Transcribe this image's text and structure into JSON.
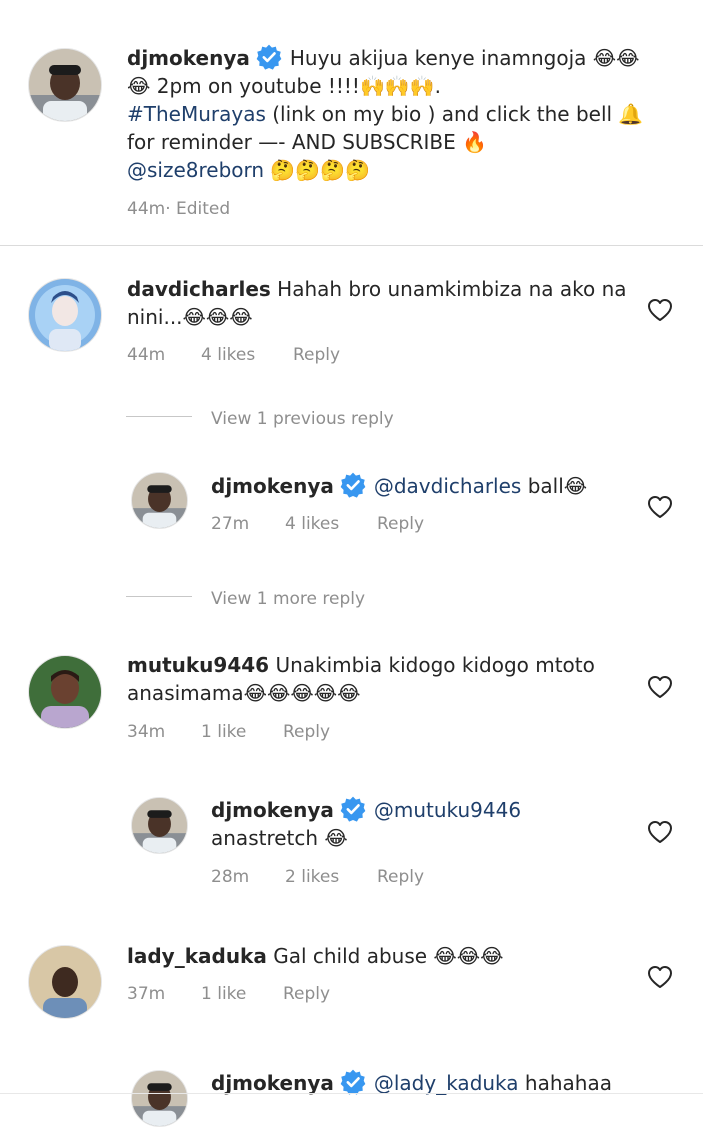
{
  "caption": {
    "username": "djmokenya",
    "line1": "Huyu akijua kenye inamngoja 😂😂",
    "line2": "😂 2pm on youtube !!!!🙌🙌🙌.",
    "hashtag": "#TheMurayas",
    "line3_rest": " (link on my bio ) and click the bell 🔔",
    "line4": "for reminder —- AND SUBSCRIBE 🔥",
    "mention": "@size8reborn",
    "line5_rest": " 🤔🤔🤔🤔",
    "time": "44m",
    "edited": " · Edited"
  },
  "comments": [
    {
      "username": "davdicharles",
      "text1": "Hahah bro unamkimbiza na ako na",
      "text2": "nini...😂😂😂",
      "time": "44m",
      "likes": "4 likes",
      "reply": "Reply"
    },
    {
      "username": "mutuku9446",
      "text1": "Unakimbia kidogo kidogo mtoto",
      "text2": "anasimama😂😂😂😂😂",
      "time": "34m",
      "likes": "1 like",
      "reply": "Reply"
    },
    {
      "username": "lady_kaduka",
      "text1": "Gal child abuse 😂😂😂",
      "time": "37m",
      "likes": "1 like",
      "reply": "Reply"
    }
  ],
  "replies": [
    {
      "username": "djmokenya",
      "mention": "@davdicharles",
      "text": " ball😂",
      "time": "27m",
      "likes": "4 likes",
      "reply": "Reply"
    },
    {
      "username": "djmokenya",
      "mention": "@mutuku9446",
      "text2": "anastretch 😂",
      "time": "28m",
      "likes": "2 likes",
      "reply": "Reply"
    },
    {
      "username": "djmokenya",
      "mention": "@lady_kaduka",
      "text": " hahahaa"
    }
  ],
  "view_replies": [
    "View 1 previous reply",
    "View 1 more reply"
  ],
  "colors": {
    "verified": "#3897f0",
    "mention": "#1f3f6b",
    "meta": "#8e8e8e"
  }
}
